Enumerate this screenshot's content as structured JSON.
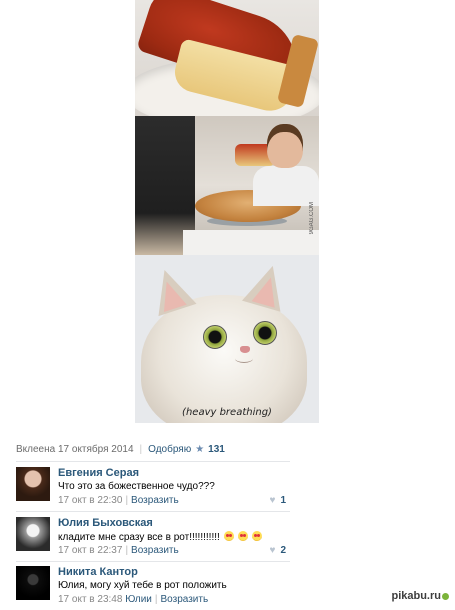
{
  "images": {
    "caption": "(heavy breathing)",
    "watermark": "9GAG.COM"
  },
  "post_meta": {
    "added": "Вклеена 17 октября 2014",
    "like_label": "Одобряю",
    "like_count": "131"
  },
  "comments": [
    {
      "author": "Евгения Серая",
      "text": "Что это за божественное чудо???",
      "time": "17 окт в 22:30",
      "reply": "Возразить",
      "likes": "1"
    },
    {
      "author": "Юлия Быховская",
      "text": "кладите мне сразу все в рот!!!!!!!!!!!",
      "time": "17 окт в 22:37",
      "reply": "Возразить",
      "likes": "2"
    },
    {
      "author": "Никита Кантор",
      "text": "Юлия, могу хуй тебе в рот положить",
      "time": "17 окт в 23:48",
      "reply_to": "Юлии",
      "reply": "Возразить",
      "likes": ""
    }
  ],
  "watermark_site": "pikabu.ru",
  "colors": {
    "link": "#2b587a",
    "muted": "#888888",
    "divider": "#e4e6e9"
  }
}
